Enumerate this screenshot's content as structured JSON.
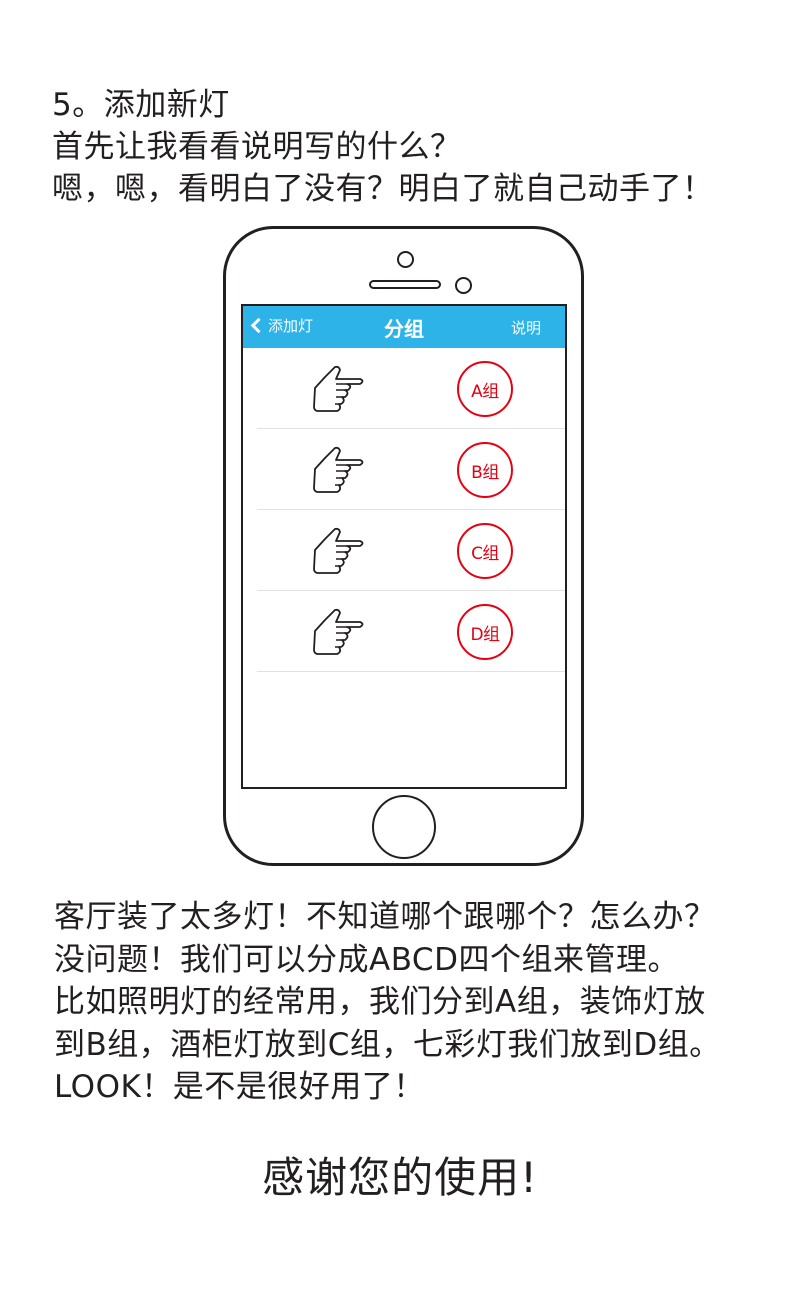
{
  "intro": {
    "line1": "5。添加新灯",
    "line2": "首先让我看看说明写的什么？",
    "line3": "嗯，嗯，看明白了没有？明白了就自己动手了！"
  },
  "app": {
    "back_label": "添加灯",
    "title": "分组",
    "help_label": "说明",
    "nav_color": "#2db3e8",
    "badge_color": "#e60012",
    "groups": [
      {
        "icon": "pointing-hand-icon",
        "label": "A组"
      },
      {
        "icon": "pointing-hand-icon",
        "label": "B组"
      },
      {
        "icon": "pointing-hand-icon",
        "label": "C组"
      },
      {
        "icon": "pointing-hand-icon",
        "label": "D组"
      }
    ]
  },
  "outro": {
    "line1": "客厅装了太多灯！不知道哪个跟哪个？怎么办？",
    "line2": "没问题！我们可以分成ABCD四个组来管理。",
    "line3": "比如照明灯的经常用，我们分到A组，装饰灯放",
    "line4": "到B组，酒柜灯放到C组，七彩灯我们放到D组。",
    "line5": "LOOK！是不是很好用了！"
  },
  "thanks": "感谢您的使用!"
}
